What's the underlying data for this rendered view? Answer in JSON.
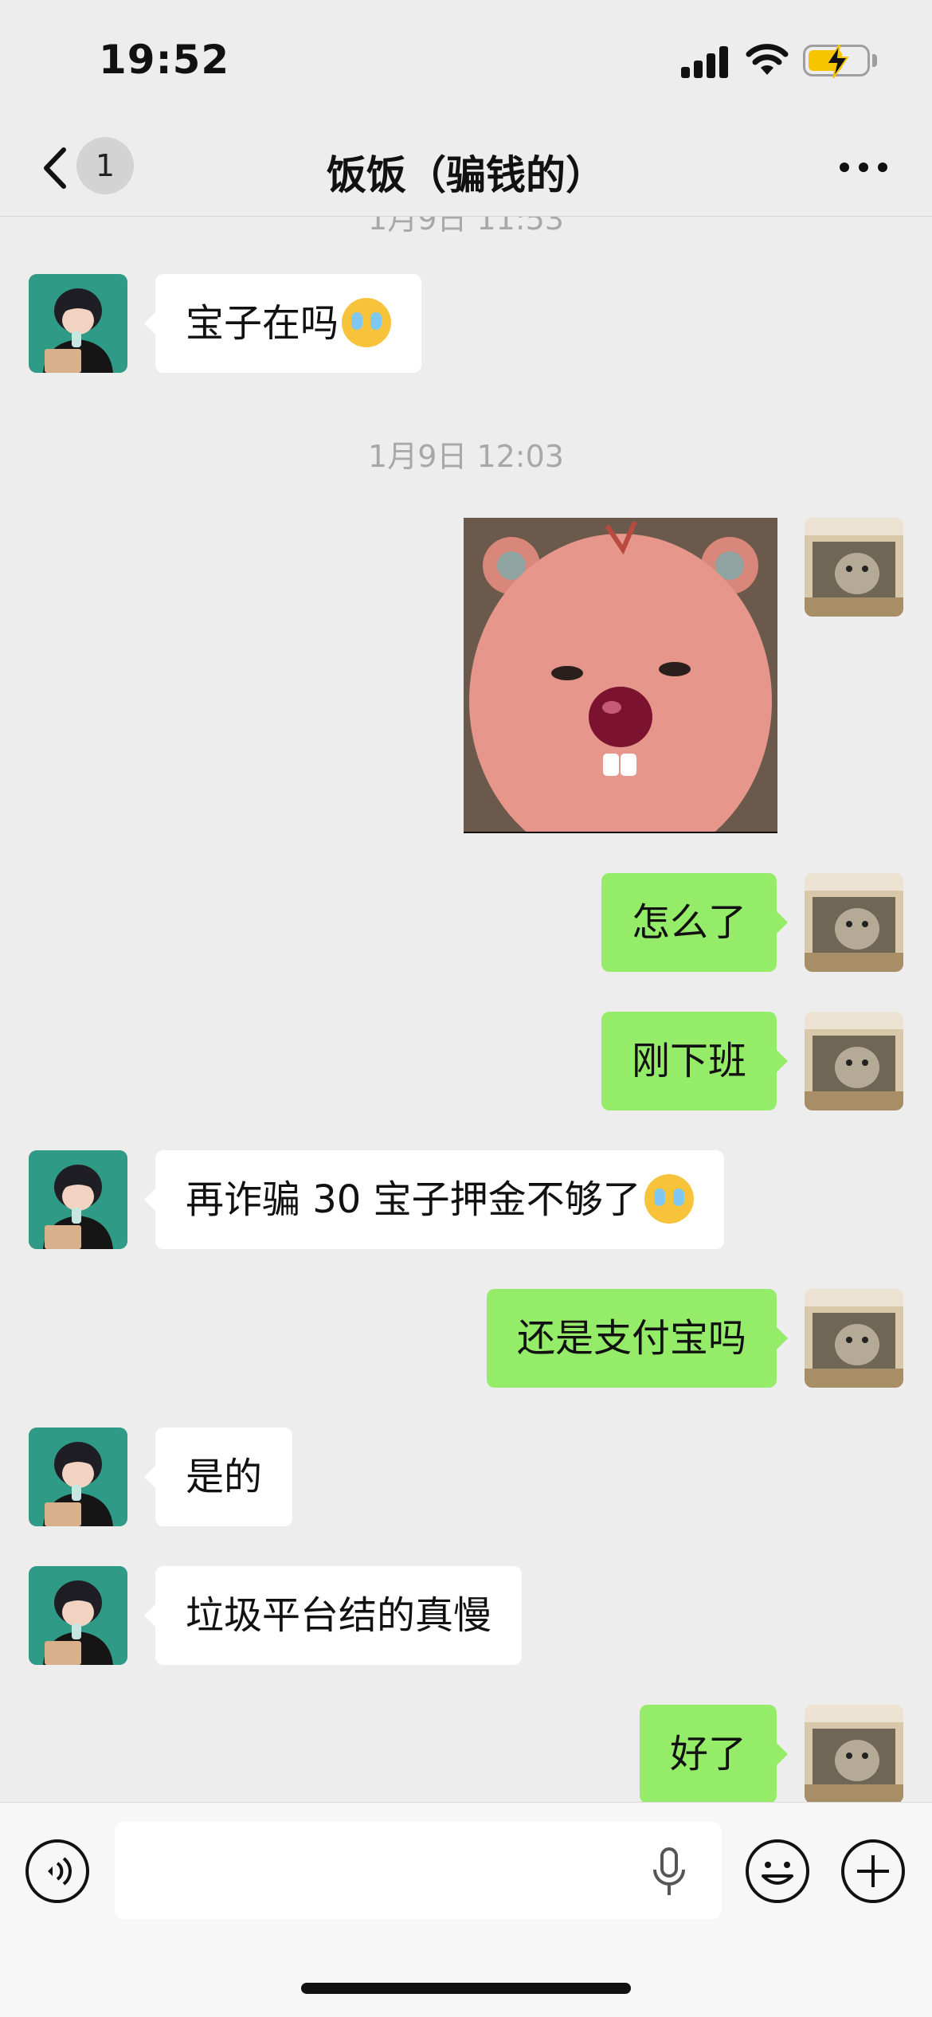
{
  "status_bar": {
    "time": "19:52",
    "battery_color": "#f7c500"
  },
  "nav": {
    "back_icon": "chevron-left-icon",
    "unread_count": "1",
    "title": "饭饭（骗钱的）",
    "more_icon": "more-horizontal-icon"
  },
  "chat": {
    "partial_timestamp": "1月9日 11:53",
    "timestamp": "1月9日 12:03",
    "messages": [
      {
        "side": "in",
        "text": "宝子在吗",
        "emoji": "crying-face-emoji"
      },
      {
        "side": "out",
        "type": "sticker",
        "sticker": "pink-beaver-sticker"
      },
      {
        "side": "out",
        "text": "怎么了"
      },
      {
        "side": "out",
        "text": "刚下班"
      },
      {
        "side": "in",
        "text": "再诈骗 30 宝子押金不够了",
        "emoji": "crying-face-emoji"
      },
      {
        "side": "out",
        "text": "还是支付宝吗"
      },
      {
        "side": "in",
        "text": "是的"
      },
      {
        "side": "in",
        "text": "垃圾平台结的真慢"
      },
      {
        "side": "out",
        "text": "好了"
      }
    ],
    "bubble_colors": {
      "incoming": "#ffffff",
      "outgoing": "#95ec69"
    }
  },
  "input_bar": {
    "voice_icon": "voice-mode-icon",
    "text_value": "",
    "mic_icon": "microphone-icon",
    "emoji_icon": "emoji-icon",
    "plus_icon": "plus-circle-icon"
  }
}
